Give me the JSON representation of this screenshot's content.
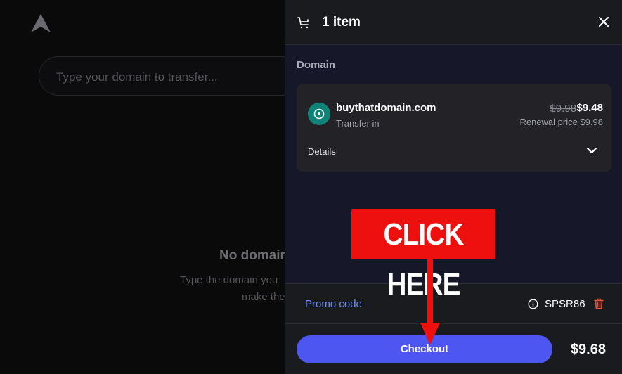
{
  "background": {
    "search_placeholder": "Type your domain to transfer...",
    "empty_title": "No domain",
    "empty_line1": "Type the domain you",
    "empty_line2": "make the"
  },
  "cart": {
    "title": "1 item",
    "section_label": "Domain",
    "item": {
      "domain": "buythatdomain.com",
      "type": "Transfer in",
      "old_price": "$9.98",
      "price": "$9.48",
      "renewal": "Renewal price $9.98",
      "details_label": "Details"
    },
    "promo_label": "Promo code",
    "promo_code": "SPSR86",
    "checkout_label": "Checkout",
    "total": "$9.68"
  },
  "overlay": {
    "callout_text": "CLICK HERE"
  },
  "colors": {
    "accent": "#4e56f2",
    "promo_link": "#6f89ff",
    "callout_red": "#ee0f0f",
    "domain_avatar": "#0e8478",
    "trash": "#e2553a"
  }
}
